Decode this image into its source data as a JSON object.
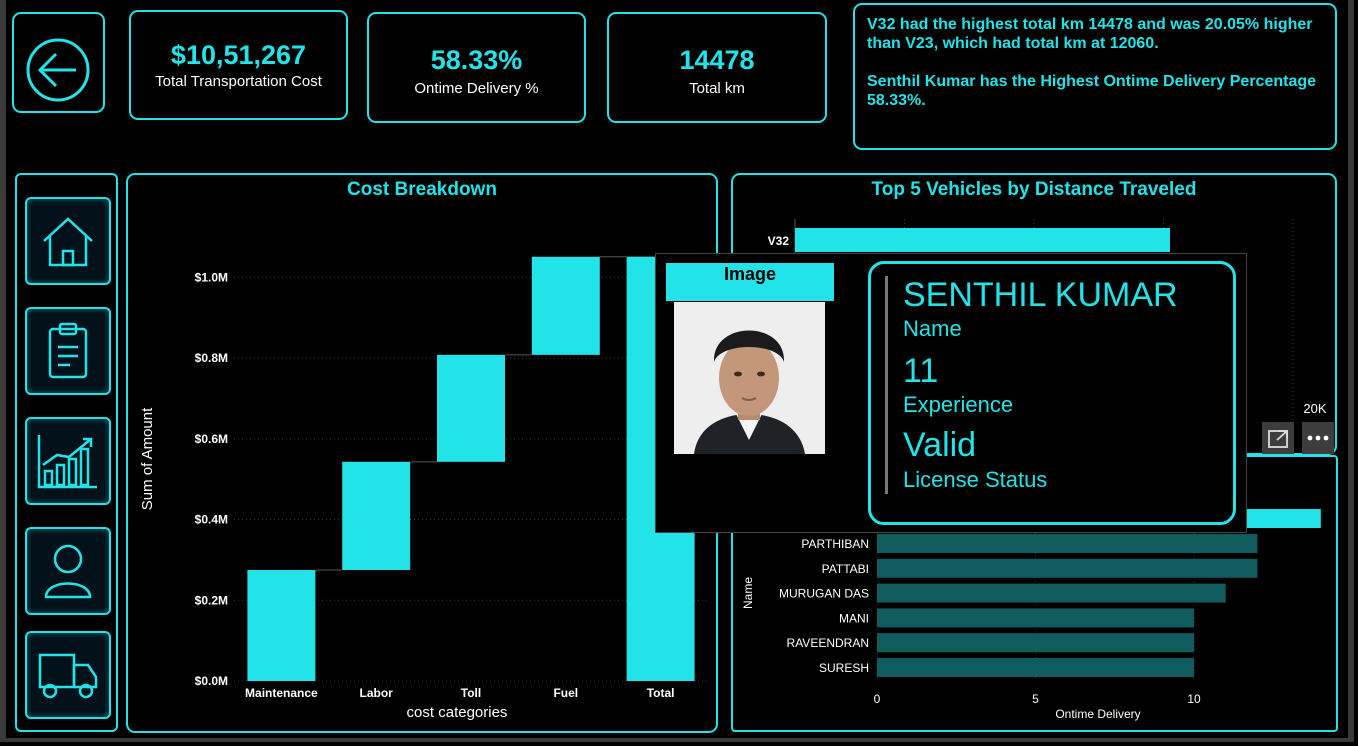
{
  "kpis": [
    {
      "value": "$10,51,267",
      "label": "Total Transportation Cost"
    },
    {
      "value": "58.33%",
      "label": "Ontime Delivery %"
    },
    {
      "value": "14478",
      "label": "Total km"
    }
  ],
  "insights": [
    "V32 had the highest total km 14478 and was 20.05% higher than V23, which had  total km at 12060.",
    "Senthil Kumar  has the Highest Ontime Delivery Percentage 58.33%."
  ],
  "nav": {
    "back_icon": "arrow-left-circle-icon",
    "items": [
      "home-icon",
      "clipboard-icon",
      "growth-chart-icon",
      "user-icon",
      "truck-icon"
    ]
  },
  "cost_chart": {
    "title": "Cost Breakdown",
    "xlabel": "cost categories",
    "ylabel": "Sum of Amount"
  },
  "vehicle_chart": {
    "title": "Top 5 Vehicles by Distance Traveled",
    "visible_category": "V32",
    "axis_max_label": "20K"
  },
  "delivery_chart": {
    "ylabel": "Name",
    "xlabel": "Ontime Delivery"
  },
  "driver_card": {
    "image_header": "Image",
    "name_value": "SENTHIL KUMAR",
    "name_label": "Name",
    "experience_value": "11",
    "experience_label": "Experience",
    "license_value": "Valid",
    "license_label": "License Status"
  },
  "colors": {
    "accent": "#22e3e8",
    "bar_dark": "#0f5b5d",
    "background": "#000000"
  },
  "chart_data": [
    {
      "type": "bar",
      "subtype": "waterfall",
      "title": "Cost Breakdown",
      "xlabel": "cost categories",
      "ylabel": "Sum of Amount",
      "categories": [
        "Maintenance",
        "Labor",
        "Toll",
        "Fuel",
        "Total"
      ],
      "values": [
        275000,
        268000,
        265000,
        243000,
        1051267
      ],
      "ylim": [
        0,
        1100000
      ],
      "yticks": [
        0,
        200000,
        400000,
        600000,
        800000,
        1000000
      ],
      "ytick_labels": [
        "$0.0M",
        "$0.2M",
        "$0.4M",
        "$0.6M",
        "$0.8M",
        "$1.0M"
      ],
      "grid": true
    },
    {
      "type": "bar",
      "orientation": "horizontal",
      "title": "Top 5 Vehicles by Distance Traveled",
      "categories": [
        "V32"
      ],
      "values": [
        14478
      ],
      "xlim": [
        0,
        20000
      ],
      "xtick_labels": [
        "20K"
      ],
      "grid": true
    },
    {
      "type": "bar",
      "orientation": "horizontal",
      "xlabel": "Ontime Delivery",
      "ylabel": "Name",
      "categories": [
        "PARTHIBAN",
        "PATTABI",
        "MURUGAN DAS",
        "MANI",
        "RAVEENDRAN",
        "SURESH"
      ],
      "values": [
        12,
        12,
        11,
        10,
        10,
        10
      ],
      "xlim": [
        0,
        14
      ],
      "xticks": [
        0,
        5,
        10
      ],
      "grid": true
    }
  ]
}
